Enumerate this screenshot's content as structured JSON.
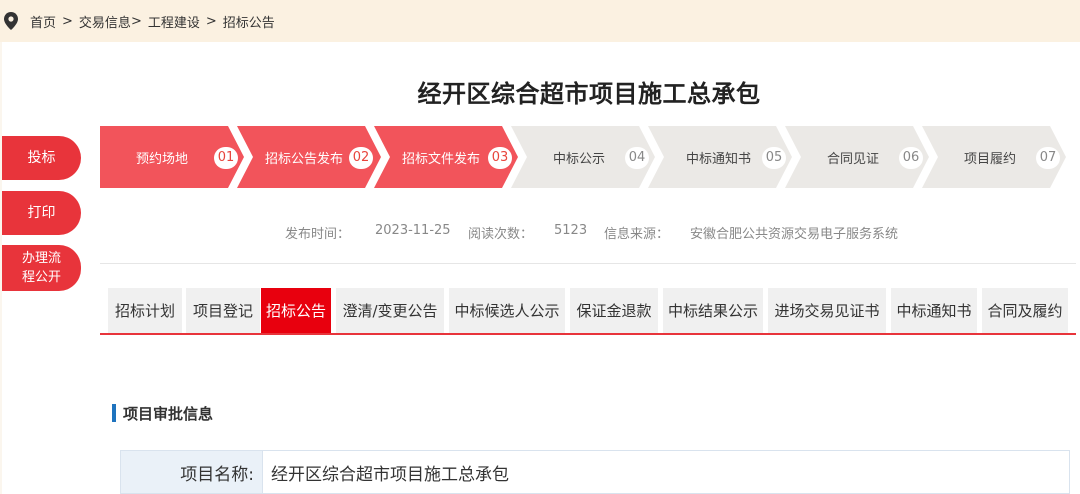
{
  "breadcrumb": {
    "home": "首页",
    "trade_info": "交易信息",
    "engineering": "工程建设",
    "current": "招标公告",
    "sep": ">"
  },
  "page_title": "经开区综合超市项目施工总承包",
  "side_buttons": {
    "bid": "投标",
    "print": "打印",
    "process_line1": "办理流",
    "process_line2": "程公开"
  },
  "steps": [
    {
      "label": "预约场地",
      "num": "01",
      "done": true
    },
    {
      "label": "招标公告发布",
      "num": "02",
      "done": true
    },
    {
      "label": "招标文件发布",
      "num": "03",
      "done": true
    },
    {
      "label": "中标公示",
      "num": "04",
      "done": false
    },
    {
      "label": "中标通知书",
      "num": "05",
      "done": false
    },
    {
      "label": "合同见证",
      "num": "06",
      "done": false
    },
    {
      "label": "项目履约",
      "num": "07",
      "done": false
    }
  ],
  "meta": {
    "publish_label": "发布时间：",
    "publish_value": "2023-11-25",
    "reads_label": "阅读次数：",
    "reads_value": "5123",
    "source_label": "信息来源：",
    "source_value": "安徽合肥公共资源交易电子服务系统"
  },
  "tabs": [
    {
      "label": "招标计划",
      "active": false
    },
    {
      "label": "项目登记",
      "active": false
    },
    {
      "label": "招标公告",
      "active": true
    },
    {
      "label": "澄清/变更公告",
      "active": false
    },
    {
      "label": "中标候选人公示",
      "active": false
    },
    {
      "label": "保证金退款",
      "active": false
    },
    {
      "label": "中标结果公示",
      "active": false
    },
    {
      "label": "进场交易见证书",
      "active": false
    },
    {
      "label": "中标通知书",
      "active": false
    },
    {
      "label": "合同及履约",
      "active": false
    }
  ],
  "section": {
    "title": "项目审批信息"
  },
  "info_table": {
    "project_name_label": "项目名称:",
    "project_name_value": "经开区综合超市项目施工总承包"
  },
  "colors": {
    "step_done": "#f2545b",
    "step_todo": "#ebe9e6",
    "accent_red": "#e8343b",
    "tab_active": "#e8000e",
    "section_bar": "#1e73be",
    "breadcrumb_bg": "#fbf1e1"
  },
  "icons": {
    "location": "location-pin-icon"
  }
}
